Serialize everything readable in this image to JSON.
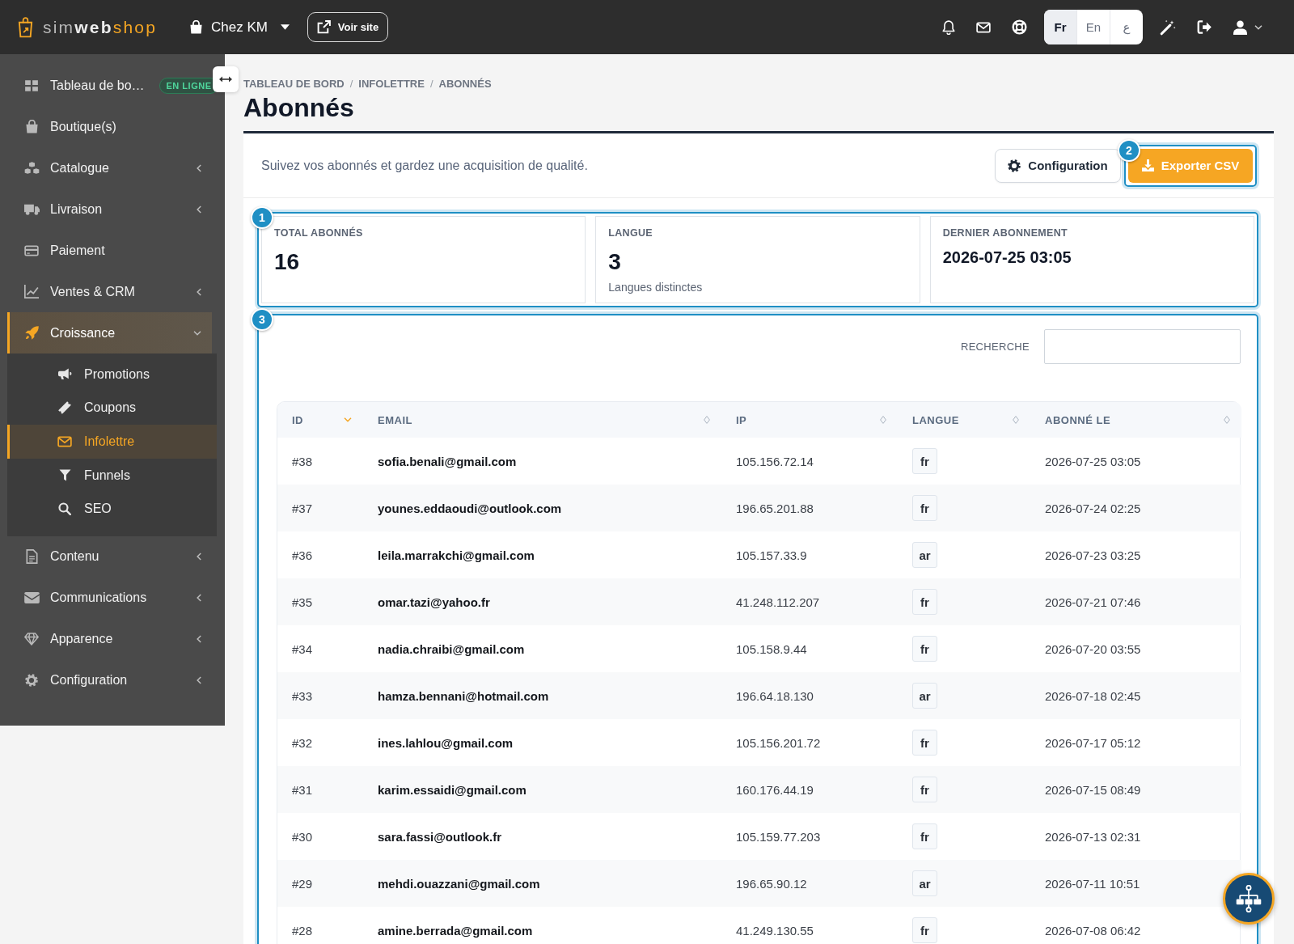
{
  "topbar": {
    "logo": [
      "sim",
      "web",
      "shop"
    ],
    "store": "Chez KM",
    "view_site": "Voir site",
    "languages": [
      {
        "label": "Fr",
        "selected": true
      },
      {
        "label": "En",
        "selected": false
      },
      {
        "label": "ع",
        "selected": false
      }
    ]
  },
  "sidebar": {
    "items": [
      {
        "label": "Tableau de bo…",
        "kind": "link",
        "selected": false,
        "badge": "EN LIGNE"
      },
      {
        "label": "Boutique(s)",
        "kind": "link",
        "selected": false
      },
      {
        "label": "Catalogue",
        "kind": "group",
        "selected": false,
        "expanded": false
      },
      {
        "label": "Livraison",
        "kind": "group",
        "selected": false,
        "expanded": false
      },
      {
        "label": "Paiement",
        "kind": "link",
        "selected": false
      },
      {
        "label": "Ventes & CRM",
        "kind": "group",
        "selected": false,
        "expanded": false
      },
      {
        "label": "Croissance",
        "kind": "group",
        "selected": true,
        "expanded": true,
        "children": [
          {
            "label": "Promotions",
            "selected": false
          },
          {
            "label": "Coupons",
            "selected": false
          },
          {
            "label": "Infolettre",
            "selected": true
          },
          {
            "label": "Funnels",
            "selected": false
          },
          {
            "label": "SEO",
            "selected": false
          }
        ]
      },
      {
        "label": "Contenu",
        "kind": "group",
        "selected": false,
        "expanded": false
      },
      {
        "label": "Communications",
        "kind": "group",
        "selected": false,
        "expanded": false
      },
      {
        "label": "Apparence",
        "kind": "group",
        "selected": false,
        "expanded": false
      },
      {
        "label": "Configuration",
        "kind": "group",
        "selected": false,
        "expanded": false
      }
    ]
  },
  "breadcrumb": [
    {
      "label": "TABLEAU DE BORD"
    },
    {
      "separator": "/",
      "label": "INFOLETTRE"
    },
    {
      "separator": "/",
      "label": "ABONNÉS"
    }
  ],
  "page_title": "Abonnés",
  "panel": {
    "description": "Suivez vos abonnés et gardez une acquisition de qualité.",
    "buttons": [
      {
        "label": "Configuration",
        "kind": "secondary"
      },
      {
        "label": "Exporter CSV",
        "kind": "primary",
        "tour_step": "2"
      }
    ],
    "stats": {
      "tour_step": "1",
      "cards": [
        {
          "label": "TOTAL ABONNÉS",
          "value": "16",
          "kind": "count"
        },
        {
          "label": "LANGUE",
          "value": "3",
          "note": "Langues distinctes",
          "kind": "count"
        },
        {
          "label": "DERNIER ABONNEMENT",
          "value": "2026-07-25 03:05",
          "kind": "datetime"
        }
      ]
    },
    "subscribers": {
      "tour_step": "3",
      "search": {
        "label": "RECHERCHE"
      },
      "table": {
        "columns": [
          {
            "label": "ID",
            "sorted": true
          },
          {
            "label": "EMAIL",
            "sorted": false
          },
          {
            "label": "IP",
            "sorted": false
          },
          {
            "label": "LANGUE",
            "sorted": false
          },
          {
            "label": "ABONNÉ LE",
            "sorted": false
          }
        ],
        "rows": [
          {
            "id": "#38",
            "email": "sofia.benali@gmail.com",
            "ip": "105.156.72.14",
            "language": "fr",
            "subscribed_at": "2026-07-25 03:05"
          },
          {
            "id": "#37",
            "email": "younes.eddaoudi@outlook.com",
            "ip": "196.65.201.88",
            "language": "fr",
            "subscribed_at": "2026-07-24 02:25"
          },
          {
            "id": "#36",
            "email": "leila.marrakchi@gmail.com",
            "ip": "105.157.33.9",
            "language": "ar",
            "subscribed_at": "2026-07-23 03:25"
          },
          {
            "id": "#35",
            "email": "omar.tazi@yahoo.fr",
            "ip": "41.248.112.207",
            "language": "fr",
            "subscribed_at": "2026-07-21 07:46"
          },
          {
            "id": "#34",
            "email": "nadia.chraibi@gmail.com",
            "ip": "105.158.9.44",
            "language": "fr",
            "subscribed_at": "2026-07-20 03:55"
          },
          {
            "id": "#33",
            "email": "hamza.bennani@hotmail.com",
            "ip": "196.64.18.130",
            "language": "ar",
            "subscribed_at": "2026-07-18 02:45"
          },
          {
            "id": "#32",
            "email": "ines.lahlou@gmail.com",
            "ip": "105.156.201.72",
            "language": "fr",
            "subscribed_at": "2026-07-17 05:12"
          },
          {
            "id": "#31",
            "email": "karim.essaidi@gmail.com",
            "ip": "160.176.44.19",
            "language": "fr",
            "subscribed_at": "2026-07-15 08:49"
          },
          {
            "id": "#30",
            "email": "sara.fassi@outlook.fr",
            "ip": "105.159.77.203",
            "language": "fr",
            "subscribed_at": "2026-07-13 02:31"
          },
          {
            "id": "#29",
            "email": "mehdi.ouazzani@gmail.com",
            "ip": "196.65.90.12",
            "language": "ar",
            "subscribed_at": "2026-07-11 10:51"
          },
          {
            "id": "#28",
            "email": "amine.berrada@gmail.com",
            "ip": "41.249.130.55",
            "language": "fr",
            "subscribed_at": "2026-07-08 06:42"
          }
        ]
      }
    }
  }
}
